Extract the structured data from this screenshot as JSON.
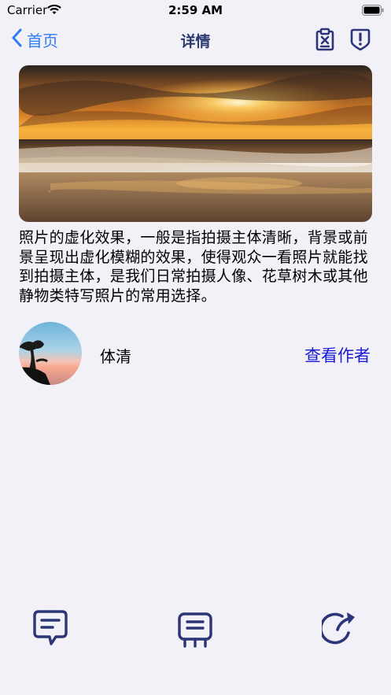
{
  "status_bar": {
    "carrier": "Carrier",
    "time": "2:59 AM"
  },
  "nav": {
    "back_label": "首页",
    "title": "详情"
  },
  "icons": {
    "back": "chevron-left-icon",
    "right": [
      "close-document-icon",
      "report-icon"
    ],
    "bottom_toolbar": [
      "comment-icon",
      "message-board-icon",
      "share-icon"
    ]
  },
  "detail": {
    "description": "照片的虚化效果，一般是指拍摄主体清晰，背景或前景呈现出虚化模糊的效果，使得观众一看照片就能找到拍摄主体，是我们日常拍摄人像、花草树木或其他静物类特写照片的常用选择。"
  },
  "author": {
    "name": "体清",
    "view_label": "查看作者"
  },
  "colors": {
    "accent": "#2f7cf6",
    "title": "#2d3a72",
    "icon": "#2b3577",
    "link": "#1a1ad6",
    "background": "#f2f1f7"
  }
}
